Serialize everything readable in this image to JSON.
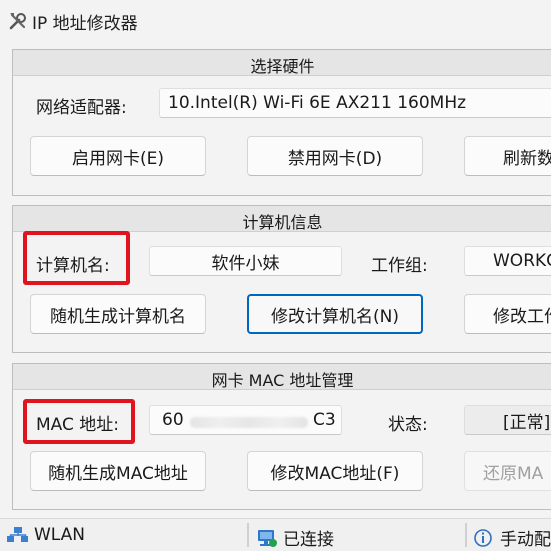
{
  "window": {
    "title": "IP 地址修改器",
    "icon": "tools-icon"
  },
  "hardware": {
    "title": "选择硬件",
    "adapter_label": "网络适配器:",
    "adapter_value": "10.Intel(R) Wi-Fi 6E AX211 160MHz",
    "enable_label": "启用网卡(E)",
    "disable_label": "禁用网卡(D)",
    "refresh_label": "刷新数"
  },
  "computer": {
    "title": "计算机信息",
    "name_label": "计算机名:",
    "name_value": "软件小妹",
    "workgroup_label": "工作组:",
    "workgroup_value": "WORKG",
    "random_name_label": "随机生成计算机名",
    "modify_name_label": "修改计算机名(N)",
    "modify_workgroup_label": "修改工作"
  },
  "mac": {
    "title": "网卡 MAC 地址管理",
    "mac_label": "MAC 地址:",
    "mac_value_start": "60",
    "mac_value_end": "C3",
    "status_label": "状态:",
    "status_value": "[正常]",
    "random_mac_label": "随机生成MAC地址",
    "modify_mac_label": "修改MAC地址(F)",
    "restore_mac_label": "还原MA"
  },
  "statusbar": {
    "network_name": "WLAN",
    "connection_status": "已连接",
    "mode": "手动配"
  },
  "colors": {
    "highlight": "#e0141e",
    "focus": "#0067c0"
  }
}
